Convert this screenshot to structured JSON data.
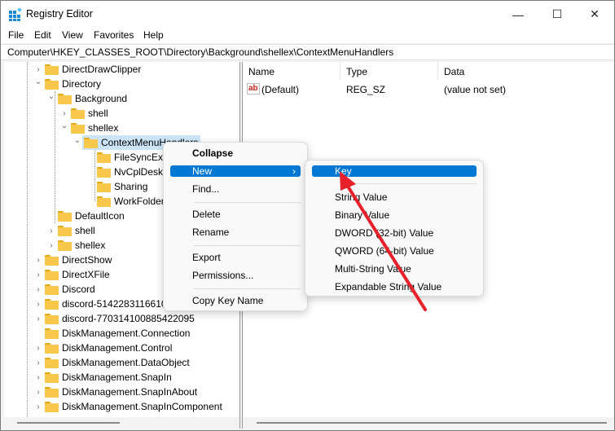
{
  "window": {
    "title": "Registry Editor",
    "minimize": "—",
    "maximize": "☐",
    "close": "✕"
  },
  "menubar": [
    "File",
    "Edit",
    "View",
    "Favorites",
    "Help"
  ],
  "address": "Computer\\HKEY_CLASSES_ROOT\\Directory\\Background\\shellex\\ContextMenuHandlers",
  "tree": [
    {
      "label": "DirectDrawClipper",
      "level": 0,
      "chev": "›"
    },
    {
      "label": "Directory",
      "level": 0,
      "chev": "⌄"
    },
    {
      "label": "Background",
      "level": 1,
      "chev": "⌄"
    },
    {
      "label": "shell",
      "level": 2,
      "chev": "›"
    },
    {
      "label": "shellex",
      "level": 2,
      "chev": "⌄"
    },
    {
      "label": "ContextMenuHandlers",
      "level": 3,
      "chev": "⌄",
      "selected": true
    },
    {
      "label": "FileSyncEx",
      "level": 4,
      "chev": ""
    },
    {
      "label": "NvCplDesk",
      "level": 4,
      "chev": ""
    },
    {
      "label": "Sharing",
      "level": 4,
      "chev": ""
    },
    {
      "label": "WorkFolders",
      "level": 4,
      "chev": ""
    },
    {
      "label": "DefaultIcon",
      "level": 1,
      "chev": ""
    },
    {
      "label": "shell",
      "level": 1,
      "chev": "›"
    },
    {
      "label": "shellex",
      "level": 1,
      "chev": "›"
    },
    {
      "label": "DirectShow",
      "level": 0,
      "chev": "›"
    },
    {
      "label": "DirectXFile",
      "level": 0,
      "chev": "›"
    },
    {
      "label": "Discord",
      "level": 0,
      "chev": "›"
    },
    {
      "label": "discord-5142283116610",
      "level": 0,
      "chev": "›"
    },
    {
      "label": "discord-770314100885422095",
      "level": 0,
      "chev": "›"
    },
    {
      "label": "DiskManagement.Connection",
      "level": 0,
      "chev": ""
    },
    {
      "label": "DiskManagement.Control",
      "level": 0,
      "chev": "›"
    },
    {
      "label": "DiskManagement.DataObject",
      "level": 0,
      "chev": "›"
    },
    {
      "label": "DiskManagement.SnapIn",
      "level": 0,
      "chev": "›"
    },
    {
      "label": "DiskManagement.SnapInAbout",
      "level": 0,
      "chev": "›"
    },
    {
      "label": "DiskManagement.SnapInComponent",
      "level": 0,
      "chev": "›"
    }
  ],
  "values": {
    "columns": [
      "Name",
      "Type",
      "Data"
    ],
    "rows": [
      {
        "icon": "ab",
        "name": "(Default)",
        "type": "REG_SZ",
        "data": "(value not set)"
      }
    ]
  },
  "context_menu": {
    "collapse": "Collapse",
    "new": "New",
    "find": "Find...",
    "delete": "Delete",
    "rename": "Rename",
    "export": "Export",
    "permissions": "Permissions...",
    "copy_key_name": "Copy Key Name",
    "submenu_arrow": "›"
  },
  "submenu": {
    "key": "Key",
    "items": [
      "String Value",
      "Binary Value",
      "DWORD (32-bit) Value",
      "QWORD (64-bit) Value",
      "Multi-String Value",
      "Expandable String Value"
    ]
  },
  "colors": {
    "accent": "#0078d4",
    "selection": "#cce4f7",
    "arrow": "#e8202a"
  }
}
